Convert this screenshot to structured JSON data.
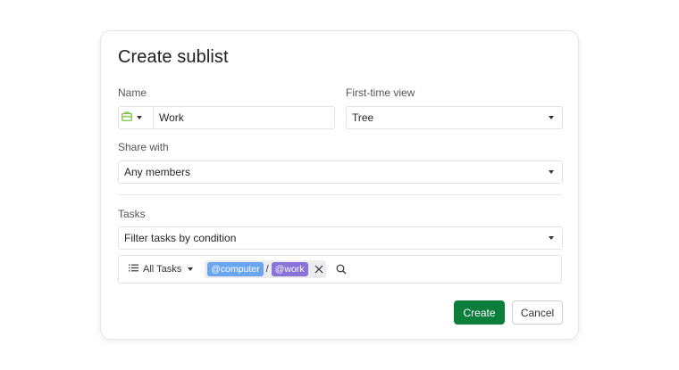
{
  "dialog": {
    "title": "Create sublist",
    "name": {
      "label": "Name",
      "value": "Work",
      "icon": "briefcase-icon",
      "icon_color": "#7ac143"
    },
    "first_view": {
      "label": "First-time view",
      "value": "Tree"
    },
    "share": {
      "label": "Share with",
      "value": "Any members"
    },
    "tasks": {
      "label": "Tasks",
      "filter_mode": "Filter tasks by condition",
      "scope": "All Tasks",
      "tags": [
        {
          "text": "@computer",
          "color": "#6aa6ef"
        },
        {
          "text": "@work",
          "color": "#8873d8"
        }
      ],
      "separator": "/"
    },
    "buttons": {
      "create": "Create",
      "cancel": "Cancel"
    },
    "colors": {
      "primary": "#0b7e3b"
    }
  }
}
